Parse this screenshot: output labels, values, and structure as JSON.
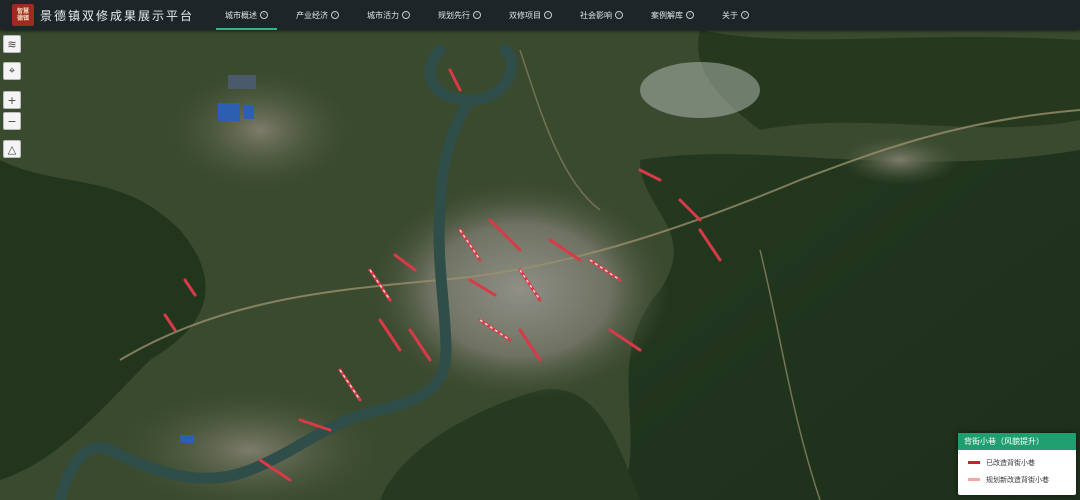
{
  "header": {
    "logo_text": "智慧德镇",
    "title": "景德镇双修成果展示平台"
  },
  "nav": {
    "items": [
      {
        "label": "城市概述",
        "active": true
      },
      {
        "label": "产业经济",
        "active": false
      },
      {
        "label": "城市活力",
        "active": false
      },
      {
        "label": "规划先行",
        "active": false
      },
      {
        "label": "双修项目",
        "active": false
      },
      {
        "label": "社会影响",
        "active": false
      },
      {
        "label": "案例解库",
        "active": false
      },
      {
        "label": "关于",
        "active": false
      }
    ],
    "arrow_icon": "chevron-circle-icon"
  },
  "map_tools": {
    "layers": "layers-icon",
    "locate": "crosshair-icon",
    "zoom_in": "+",
    "zoom_out": "−",
    "measure": "ruler-icon"
  },
  "legend": {
    "title": "背街小巷（风貌提升）",
    "items": [
      {
        "label": "已改造背街小巷",
        "color": "#c8222f"
      },
      {
        "label": "规划新改造背街小巷",
        "color": "#f0a8a8"
      }
    ]
  },
  "colors": {
    "topbar": "#1e2528",
    "accent": "#2eb88a",
    "route_highlight": "#d83a48",
    "river": "#2f4d49"
  }
}
